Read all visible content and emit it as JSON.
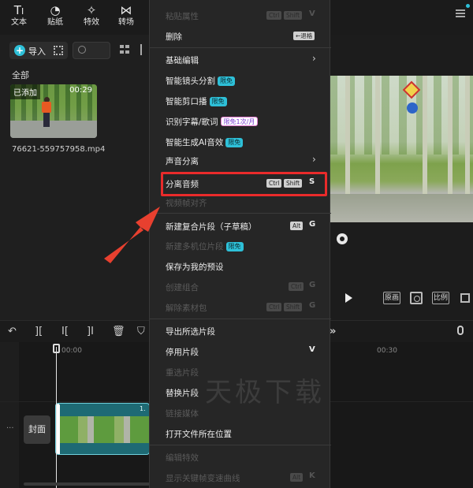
{
  "toolbar": {
    "tools": [
      {
        "label": "文本",
        "icon": "text-icon"
      },
      {
        "label": "贴纸",
        "icon": "sticker-icon"
      },
      {
        "label": "特效",
        "icon": "effects-icon"
      },
      {
        "label": "转场",
        "icon": "transition-icon"
      }
    ]
  },
  "media": {
    "import_label": "导入",
    "category_label": "全部",
    "clip": {
      "added_label": "已添加",
      "duration": "00:29",
      "filename": "76621-559757958.mp4"
    }
  },
  "player": {
    "ratio_original": "原画",
    "ratio_label": "比例"
  },
  "timeline": {
    "time_start": "00:00",
    "time_mid": "00:30",
    "cover_label": "封面",
    "clip_title": "1."
  },
  "context_menu": {
    "items": [
      {
        "label": "粘贴属性",
        "disabled": true,
        "keys": [
          "Ctrl",
          "Shift"
        ],
        "key": "V"
      },
      {
        "label": "删除",
        "disabled": false,
        "keys": [
          "←退格"
        ],
        "key": ""
      },
      {
        "label": "基础编辑",
        "disabled": false,
        "submenu": true
      },
      {
        "label": "智能镜头分割",
        "disabled": false,
        "badge": "限免"
      },
      {
        "label": "智能剪口播",
        "disabled": false,
        "badge": "限免"
      },
      {
        "label": "识别字幕/歌词",
        "disabled": false,
        "badge": "限免1次/月"
      },
      {
        "label": "智能生成AI音效",
        "disabled": false,
        "badge": "限免"
      },
      {
        "label": "声音分离",
        "disabled": false,
        "submenu": true
      },
      {
        "label": "分离音频",
        "disabled": false,
        "keys": [
          "Ctrl",
          "Shift"
        ],
        "key": "S"
      },
      {
        "label": "视频帧对齐",
        "disabled": true
      },
      {
        "label": "新建复合片段（子草稿）",
        "disabled": false,
        "keys": [
          "Alt"
        ],
        "key": "G"
      },
      {
        "label": "新建多机位片段",
        "disabled": true,
        "badge": "限免"
      },
      {
        "label": "保存为我的预设",
        "disabled": false
      },
      {
        "label": "创建组合",
        "disabled": true,
        "keys": [
          "Ctrl"
        ],
        "key": "G"
      },
      {
        "label": "解除素材包",
        "disabled": true,
        "keys": [
          "Ctrl",
          "Shift"
        ],
        "key": "G"
      },
      {
        "label": "导出所选片段",
        "disabled": false
      },
      {
        "label": "停用片段",
        "disabled": false,
        "key": "V"
      },
      {
        "label": "重选片段",
        "disabled": true
      },
      {
        "label": "替换片段",
        "disabled": false
      },
      {
        "label": "链接媒体",
        "disabled": true
      },
      {
        "label": "打开文件所在位置",
        "disabled": false
      },
      {
        "label": "编辑特效",
        "disabled": true
      },
      {
        "label": "显示关键帧变速曲线",
        "disabled": true,
        "keys": [
          "Alt"
        ],
        "key": "K"
      }
    ]
  },
  "watermark": "天极下载",
  "colors": {
    "accent": "#2ec0d8",
    "highlight": "#ea2b2b",
    "arrow": "#e8402f"
  }
}
